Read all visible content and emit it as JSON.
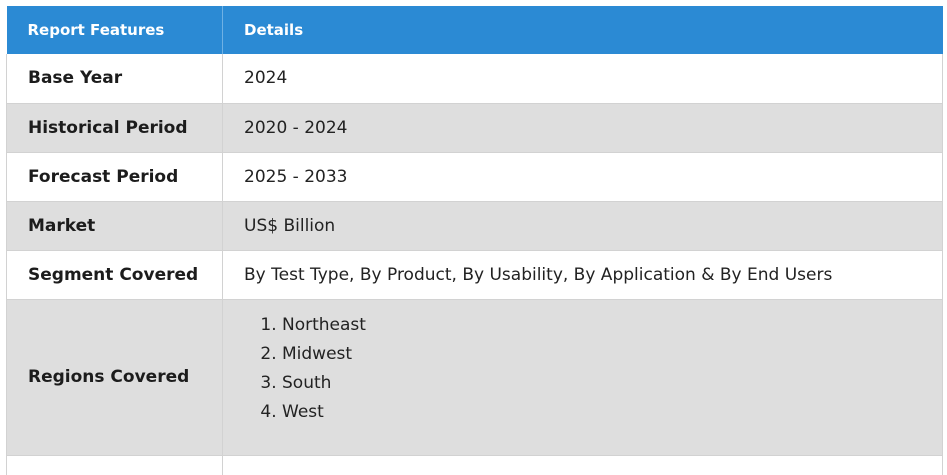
{
  "header": {
    "col1": "Report Features",
    "col2": "Details"
  },
  "rows": [
    {
      "feature": "Base Year",
      "detail": "2024"
    },
    {
      "feature": "Historical Period",
      "detail": "2020 - 2024"
    },
    {
      "feature": "Forecast Period",
      "detail": "2025 - 2033"
    },
    {
      "feature": "Market",
      "detail": "US$ Billion"
    },
    {
      "feature": "Segment Covered",
      "detail": "By Test Type, By Product, By Usability, By Application & By End Users"
    }
  ],
  "regions": {
    "feature": "Regions Covered",
    "items": [
      "Northeast",
      "Midwest",
      "South",
      "West"
    ]
  },
  "colors": {
    "header_bg": "#2b8ad4",
    "stripe_bg": "#dedede",
    "header_text": "#ffffff"
  }
}
